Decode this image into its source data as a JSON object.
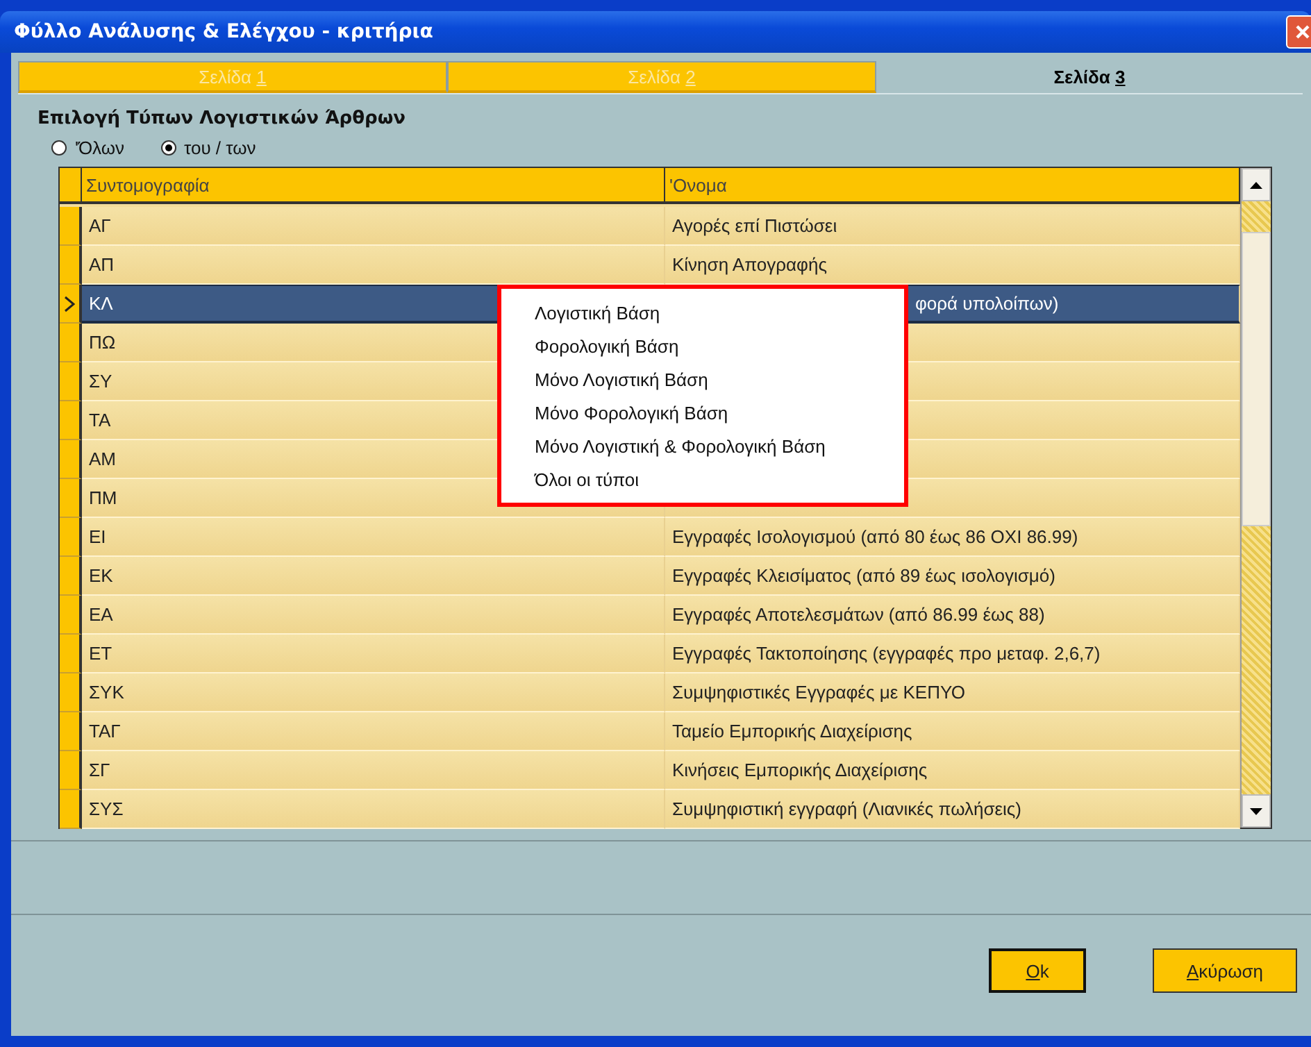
{
  "window": {
    "title": "Φύλλο Ανάλυσης & Ελέγχου - κριτήρια"
  },
  "tabs": [
    {
      "label": "Σελίδα ",
      "key": "1",
      "selected": false
    },
    {
      "label": "Σελίδα ",
      "key": "2",
      "selected": false
    },
    {
      "label": "Σελίδα ",
      "key": "3",
      "selected": true
    }
  ],
  "section_title": "Επιλογή Τύπων Λογιστικών Άρθρων",
  "radios": [
    {
      "label": "'Όλων",
      "selected": false
    },
    {
      "label": "του / των",
      "selected": true
    }
  ],
  "table": {
    "columns": [
      "Συντομογραφία",
      "'Ονομα"
    ],
    "rows": [
      {
        "code": "ΑΓ",
        "name": "Αγορές επί Πιστώσει",
        "selected": false
      },
      {
        "code": "ΑΠ",
        "name": "Κίνηση Απογραφής",
        "selected": false
      },
      {
        "code": "ΚΛ",
        "name": "φορά υπολοίπων)",
        "selected": true
      },
      {
        "code": "ΠΩ",
        "selected": false
      },
      {
        "code": "ΣΥ",
        "selected": false
      },
      {
        "code": "ΤΑ",
        "selected": false
      },
      {
        "code": "ΑΜ",
        "selected": false
      },
      {
        "code": "ΠΜ",
        "selected": false
      },
      {
        "code": "ΕΙ",
        "name": "Εγγραφές Ισολογισμού (από 80 έως 86 ΟΧΙ 86.99)",
        "selected": false
      },
      {
        "code": "ΕΚ",
        "name": "Εγγραφές Κλεισίματος (από 89 έως ισολογισμό)",
        "selected": false
      },
      {
        "code": "ΕΑ",
        "name": "Εγγραφές Αποτελεσμάτων (από 86.99 έως 88)",
        "selected": false
      },
      {
        "code": "ΕΤ",
        "name": "Εγγραφές Τακτοποίησης (εγγραφές προ μεταφ. 2,6,7)",
        "selected": false
      },
      {
        "code": "ΣΥΚ",
        "name": "Συμψηφιστικές Εγγραφές με ΚΕΠΥΟ",
        "selected": false
      },
      {
        "code": "ΤΑΓ",
        "name": "Ταμείο Εμπορικής Διαχείρισης",
        "selected": false
      },
      {
        "code": "ΣΓ",
        "name": "Κινήσεις Εμπορικής Διαχείρισης",
        "selected": false
      },
      {
        "code": "ΣΥΣ",
        "name": "Συμψηφιστική εγγραφή (Λιανικές πωλήσεις)",
        "selected": false
      }
    ]
  },
  "popup_menu": [
    "Λογιστική Βάση",
    "Φορολογική Βάση",
    "Μόνο Λογιστική Βάση",
    "Μόνο Φορολογική Βάση",
    "Μόνο Λογιστική & Φορολογική Βάση",
    "Όλοι οι τύποι"
  ],
  "buttons": [
    {
      "key": "O",
      "after": "k",
      "kind": "default"
    },
    {
      "key": "Α",
      "after": "κύρωση",
      "kind": "normal"
    }
  ]
}
